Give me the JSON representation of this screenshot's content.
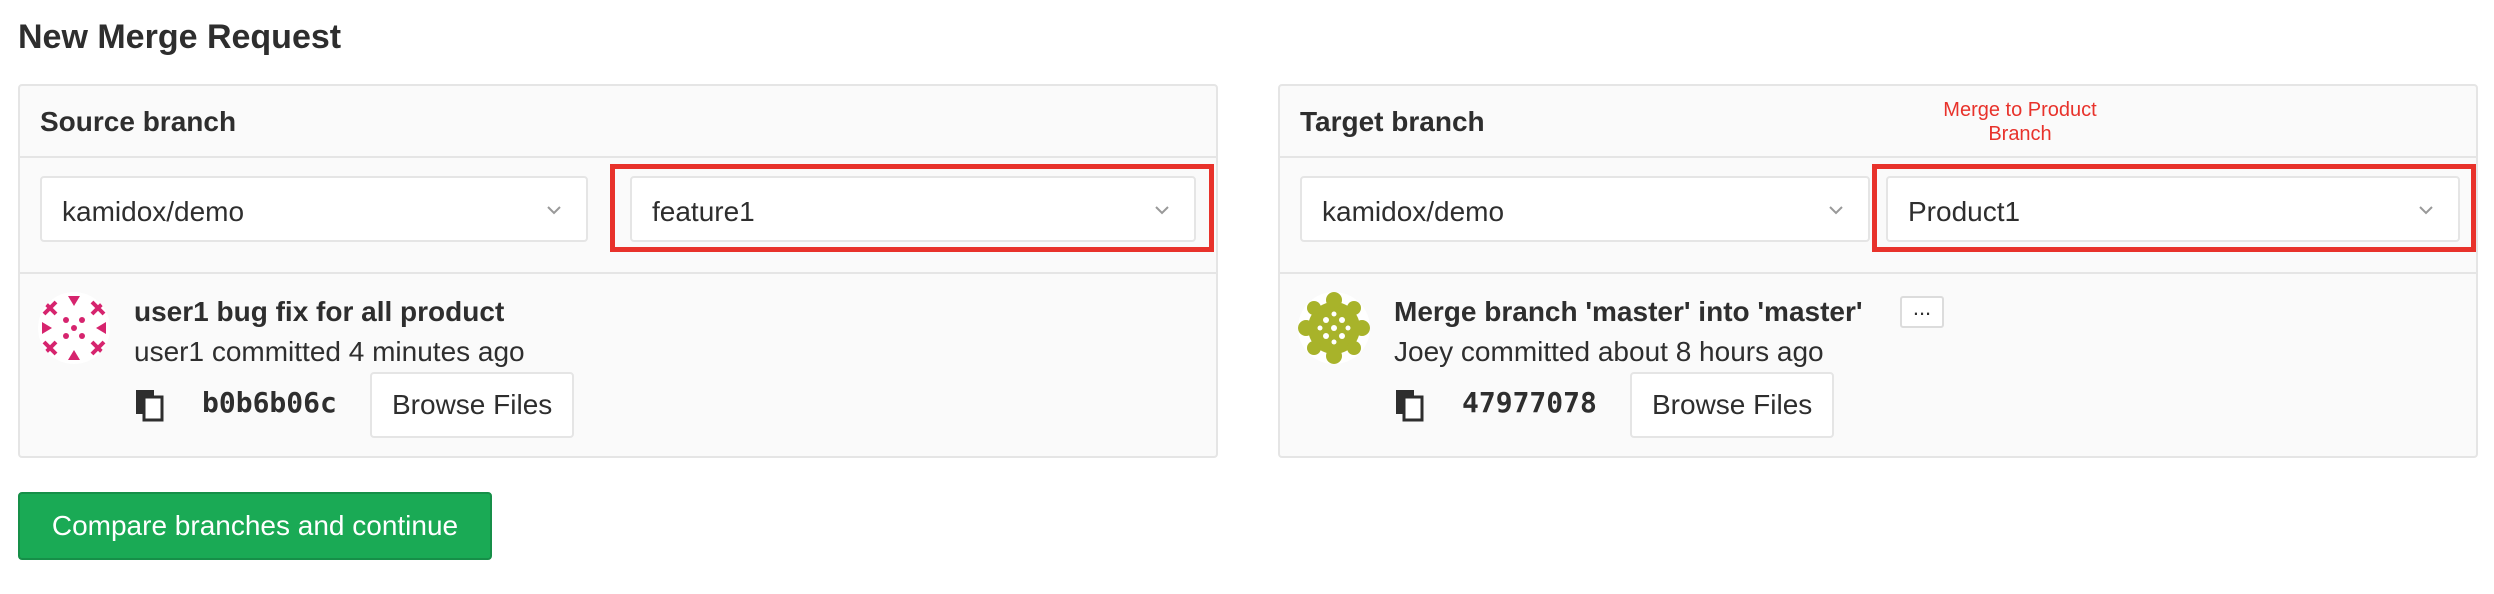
{
  "page": {
    "title": "New Merge Request"
  },
  "source": {
    "header": "Source branch",
    "project": "kamidox/demo",
    "branch": "feature1",
    "commit": {
      "title": "user1 bug fix for all product",
      "meta": "user1 committed 4 minutes ago",
      "sha": "b0b6b06c",
      "browse_label": "Browse Files"
    }
  },
  "target": {
    "header": "Target branch",
    "project": "kamidox/demo",
    "branch": "Product1",
    "annotation": "Merge to Product Branch",
    "commit": {
      "title": "Merge branch 'master' into 'master'",
      "ellipsis": "...",
      "meta": "Joey committed about 8 hours ago",
      "sha": "47977078",
      "browse_label": "Browse Files"
    }
  },
  "actions": {
    "compare_label": "Compare branches and continue"
  },
  "colors": {
    "highlight": "#e8322b",
    "primary": "#1aaa55",
    "avatar_source": "#d6246e",
    "avatar_target": "#a8b32a"
  },
  "icons": [
    "chevron-down-icon",
    "copy-icon"
  ]
}
